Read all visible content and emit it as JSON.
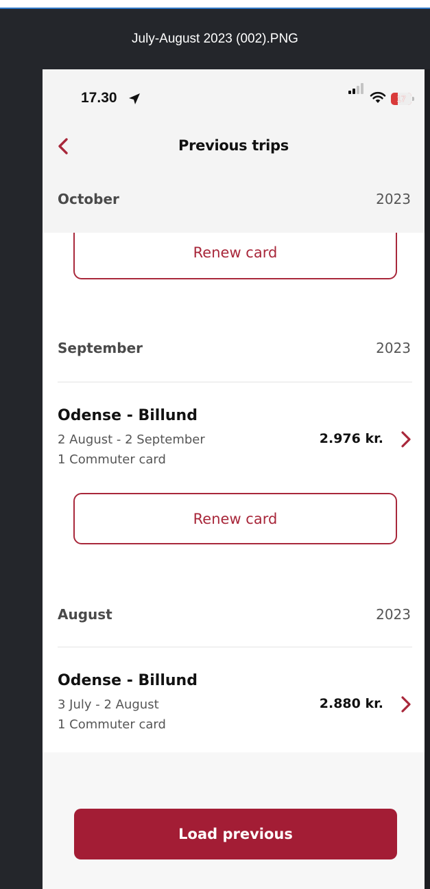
{
  "window": {
    "title": "July-August 2023 (002).PNG"
  },
  "statusbar": {
    "time": "17.30",
    "battery": "17"
  },
  "nav": {
    "title": "Previous trips"
  },
  "sections": [
    {
      "month": "October",
      "year": "2023"
    },
    {
      "month": "September",
      "year": "2023"
    },
    {
      "month": "August",
      "year": "2023"
    }
  ],
  "trips": [
    {
      "route": "Odense - Billund",
      "dates": "2 August - 2 September",
      "type": "1 Commuter card",
      "price": "2.976 kr."
    },
    {
      "route": "Odense - Billund",
      "dates": "3 July - 2 August",
      "type": "1 Commuter card",
      "price": "2.880 kr."
    }
  ],
  "actions": {
    "renew": "Renew card",
    "load_previous": "Load previous"
  },
  "colors": {
    "accent": "#a31d35",
    "outline": "#a8273a",
    "background": "#24262b"
  }
}
